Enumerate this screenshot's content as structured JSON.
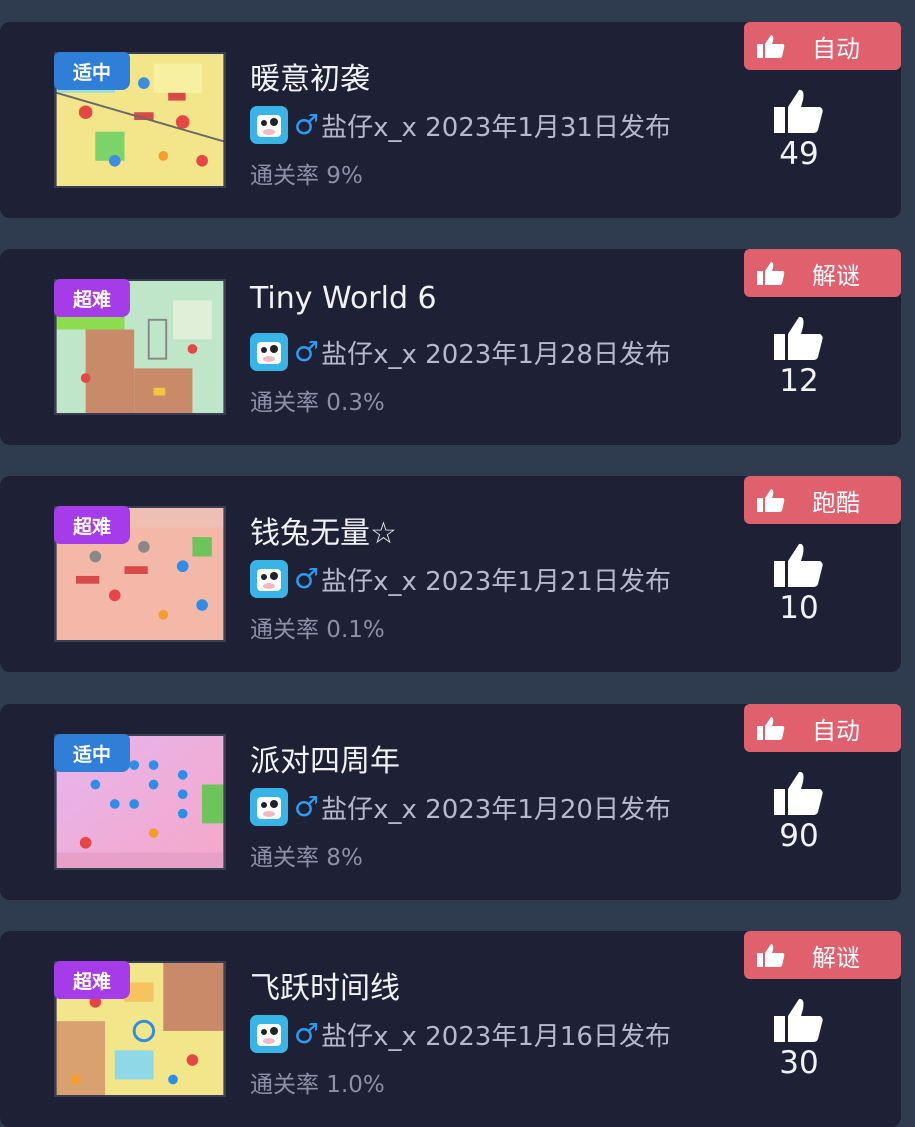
{
  "levels": [
    {
      "difficulty": "适中",
      "title": "暖意初袭",
      "gender": "♂",
      "author_date": "盐仔x_x 2023年1月31日发布",
      "clear_rate": "通关率 9%",
      "tag": "自动",
      "likes": "49"
    },
    {
      "difficulty": "超难",
      "title": "Tiny World 6",
      "gender": "♂",
      "author_date": "盐仔x_x 2023年1月28日发布",
      "clear_rate": "通关率 0.3%",
      "tag": "解谜",
      "likes": "12"
    },
    {
      "difficulty": "超难",
      "title": "钱兔无量☆",
      "gender": "♂",
      "author_date": "盐仔x_x 2023年1月21日发布",
      "clear_rate": "通关率 0.1%",
      "tag": "跑酷",
      "likes": "10"
    },
    {
      "difficulty": "适中",
      "title": "派对四周年",
      "gender": "♂",
      "author_date": "盐仔x_x 2023年1月20日发布",
      "clear_rate": "通关率 8%",
      "tag": "自动",
      "likes": "90"
    },
    {
      "difficulty": "超难",
      "title": "飞跃时间线",
      "gender": "♂",
      "author_date": "盐仔x_x 2023年1月16日发布",
      "clear_rate": "通关率 1.0%",
      "tag": "解谜",
      "likes": "30"
    }
  ],
  "colors": {
    "card_bg": "#1e2036",
    "page_bg": "#2f3b4f",
    "tag_bg": "#e0606e",
    "difficulty_medium": "#2f7fd8",
    "difficulty_hard": "#a63be9",
    "gender": "#2b9cf2"
  },
  "icons": {
    "tag": "thumbs-up-icon",
    "likes": "thumbs-up-icon",
    "avatar": "cow-avatar-icon"
  }
}
